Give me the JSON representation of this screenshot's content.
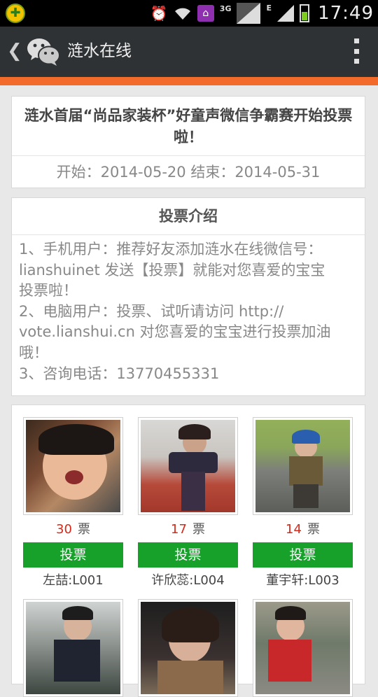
{
  "status_bar": {
    "time": "17:49",
    "network_3g": "3G",
    "network_e": "E"
  },
  "header": {
    "title": "涟水在线"
  },
  "event": {
    "title": "涟水首届“尚品家装杯”好童声微信争霸赛开始投票啦！",
    "dates": "开始：2014-05-20  结束：2014-05-31"
  },
  "intro": {
    "heading": "投票介绍",
    "lines": [
      "1、手机用户：推荐好友添加涟水在线微信号：",
      "lianshuinet 发送【投票】就能对您喜爱的宝宝",
      "投票啦！",
      "2、电脑用户：投票、试听请访问 http://",
      "vote.lianshui.cn 对您喜爱的宝宝进行投票加油",
      "哦！",
      "3、咨询电话：13770455331"
    ]
  },
  "contestants": [
    {
      "votes": "30",
      "vote_unit": "票",
      "vote_label": "投票",
      "name": "左喆:L001"
    },
    {
      "votes": "17",
      "vote_unit": "票",
      "vote_label": "投票",
      "name": "许欣蕊:L004"
    },
    {
      "votes": "14",
      "vote_unit": "票",
      "vote_label": "投票",
      "name": "董宇轩:L003"
    },
    {
      "votes": "",
      "vote_unit": "",
      "vote_label": "",
      "name": ""
    },
    {
      "votes": "",
      "vote_unit": "",
      "vote_label": "",
      "name": ""
    },
    {
      "votes": "",
      "vote_unit": "",
      "vote_label": "",
      "name": ""
    }
  ],
  "colors": {
    "header_bg": "#2f3234",
    "accent_orange": "#f26b2a",
    "vote_green": "#17a12a",
    "vote_count_red": "#d32a1a"
  },
  "icons": [
    "back-chevron-icon",
    "wechat-logo-icon",
    "more-vert-icon",
    "alarm-icon",
    "wifi-icon",
    "home-icon",
    "signal-icon",
    "battery-icon"
  ]
}
